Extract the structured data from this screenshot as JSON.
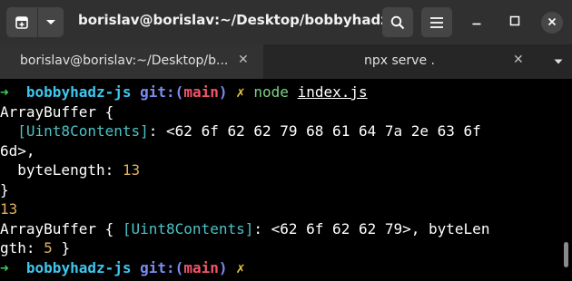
{
  "titlebar": {
    "title": "borislav@borislav:~/Desktop/bobbyhadz-r...",
    "icons": [
      "new-tab-icon",
      "dropdown-icon",
      "search-icon",
      "menu-icon",
      "minimize-icon",
      "maximize-icon",
      "close-icon"
    ]
  },
  "tabs": [
    {
      "label": "borislav@borislav:~/Desktop/b...",
      "close": "✕",
      "active": true
    },
    {
      "label": "npx serve .",
      "close": "✕",
      "active": false
    }
  ],
  "terminal": {
    "prompt_arrow": "➜",
    "dir": "bobbyhadz-js",
    "git_label": "git:(",
    "branch": "main",
    "git_close": ")",
    "dirty_mark": "✗",
    "cmd": "node",
    "arg": "index.js",
    "l2": "ArrayBuffer {",
    "l3_key": "[Uint8Contents]",
    "l3_val": ": <62 6f 62 62 79 68 61 64 7a 2e 63 6f",
    "l4": "6d>,",
    "l5_key": "byteLength: ",
    "l5_val": "13",
    "l6": "}",
    "l7": "13",
    "l8_a": "ArrayBuffer { ",
    "l8_key": "[Uint8Contents]",
    "l8_b": ": <62 6f 62 62 79>, byteLen",
    "l9_a": "gth: ",
    "l9_val": "5",
    "l9_b": " }"
  },
  "colors": {
    "prompt_green": "#39d05a",
    "dir_cyan": "#3fc6ee",
    "git_blue": "#7c8bf0",
    "branch_red": "#f0566a",
    "dirty_yellow": "#e8c33a"
  }
}
